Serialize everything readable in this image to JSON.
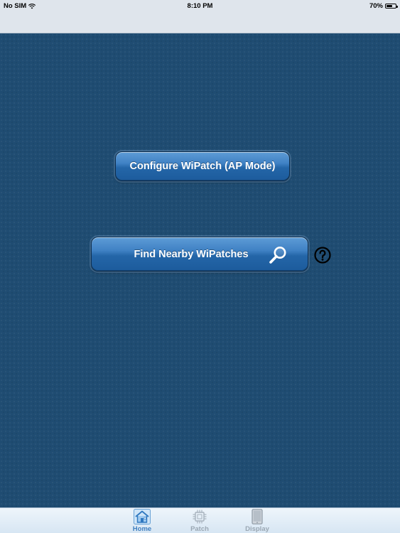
{
  "status_bar": {
    "carrier": "No SIM",
    "time": "8:10 PM",
    "battery_percent": "70%",
    "battery_level": 0.7
  },
  "main": {
    "configure_button_label": "Configure WiPatch (AP Mode)",
    "find_button_label": "Find Nearby WiPatches",
    "find_button_icon": "magnifier-icon",
    "help_icon": "question-circle-icon"
  },
  "tab_bar": {
    "tabs": [
      {
        "label": "Home",
        "icon": "house-icon",
        "active": true
      },
      {
        "label": "Patch",
        "icon": "chip-icon",
        "active": false
      },
      {
        "label": "Display",
        "icon": "tablet-icon",
        "active": false
      }
    ]
  },
  "colors": {
    "background": "#1f4c72",
    "button_blue": "#2466a8",
    "bar_background": "#dfe5ec",
    "tab_active": "#3f7fc0",
    "tab_inactive": "#9aa7b3"
  }
}
